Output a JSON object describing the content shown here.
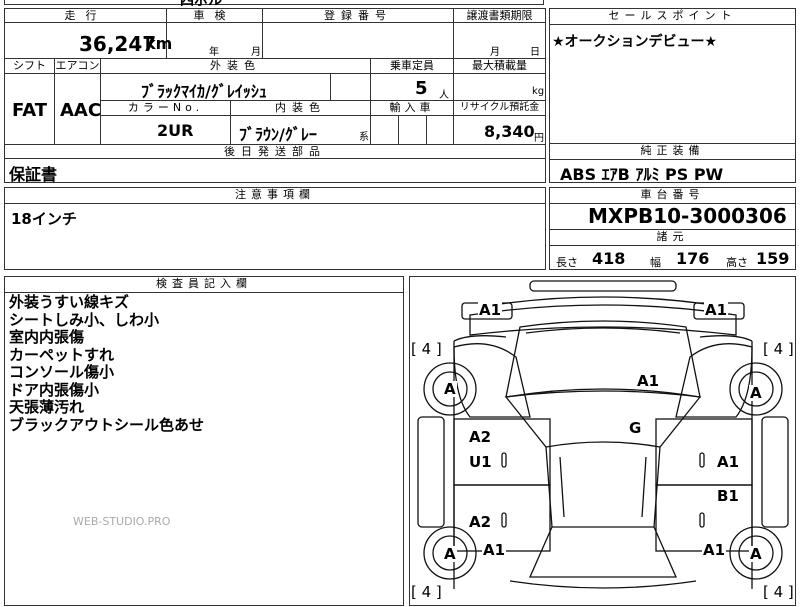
{
  "top_partial": {
    "fragment": "四ボル"
  },
  "grid": {
    "mileage_label": "走行",
    "mileage_value": "36,247",
    "mileage_unit": "km",
    "inspection_label": "車検",
    "inspection_year_unit": "年",
    "inspection_month_unit": "月",
    "registration_label": "登録番号",
    "transfer_label": "譲渡書類期限",
    "transfer_month_unit": "月",
    "transfer_day_unit": "日",
    "shift_label": "シフト",
    "shift_value": "FAT",
    "ac_label": "エアコン",
    "ac_value": "AAC",
    "exterior_color_label": "外装色",
    "exterior_color_value": "ﾌﾞﾗｯｸﾏｲｶ/ｸﾞﾚｲｯｼｭ",
    "capacity_label": "乗車定員",
    "capacity_value": "5",
    "capacity_unit": "人",
    "max_load_label": "最大積載量",
    "max_load_unit": "kg",
    "color_no_label": "カラーNo.",
    "color_no_value": "2UR",
    "interior_color_label": "内装色",
    "interior_color_value": "ﾌﾞﾗｳﾝ/ｸﾞﾚｰ",
    "interior_color_suffix": "系",
    "import_label": "輸入車",
    "recycle_label": "リサイクル預託金",
    "recycle_value": "8,340",
    "recycle_unit": "円",
    "later_parts_label": "後日発送部品",
    "later_parts_value": "保証書"
  },
  "sales_point": {
    "label": "セールスポイント",
    "value": "★オークションデビュー★"
  },
  "equipment": {
    "label": "純正装備",
    "value": "ABS ｴｱB ｱﾙﾐ PS PW"
  },
  "caution": {
    "label": "注意事項欄",
    "value": "18インチ"
  },
  "chassis": {
    "label": "車台番号",
    "value": "MXPB10-3000306"
  },
  "specs": {
    "label": "諸元",
    "length_label": "長さ",
    "length_value": "418",
    "width_label": "幅",
    "width_value": "176",
    "height_label": "高さ",
    "height_value": "159"
  },
  "inspector": {
    "label": "検査員記入欄",
    "notes": [
      "外装うすい線キズ",
      "シートしみ小、しわ小",
      "室内内張傷",
      "カーペットすれ",
      "コンソール傷小",
      "ドア内張傷小",
      "天張薄汚れ",
      "ブラックアウトシール色あせ"
    ],
    "watermark": "WEB-STUDIO.PRO"
  },
  "diagram": {
    "marks": {
      "a1_tl": "A1",
      "a1_tr": "A1",
      "tire_fl": "[ 4 ]",
      "tire_fr": "[ 4 ]",
      "wheel_fl": "A",
      "wheel_fr": "A",
      "a1_hood": "A1",
      "g_windshield": "G",
      "a2_left": "A2",
      "u1_left": "U1",
      "a1_right": "A1",
      "b1_right": "B1",
      "a2_left_rear": "A2",
      "wheel_rl": "A",
      "wheel_rr": "A",
      "a1_rl": "A1",
      "a1_rr": "A1",
      "tire_rl": "[ 4 ]",
      "tire_rr": "[ 4 ]"
    }
  }
}
